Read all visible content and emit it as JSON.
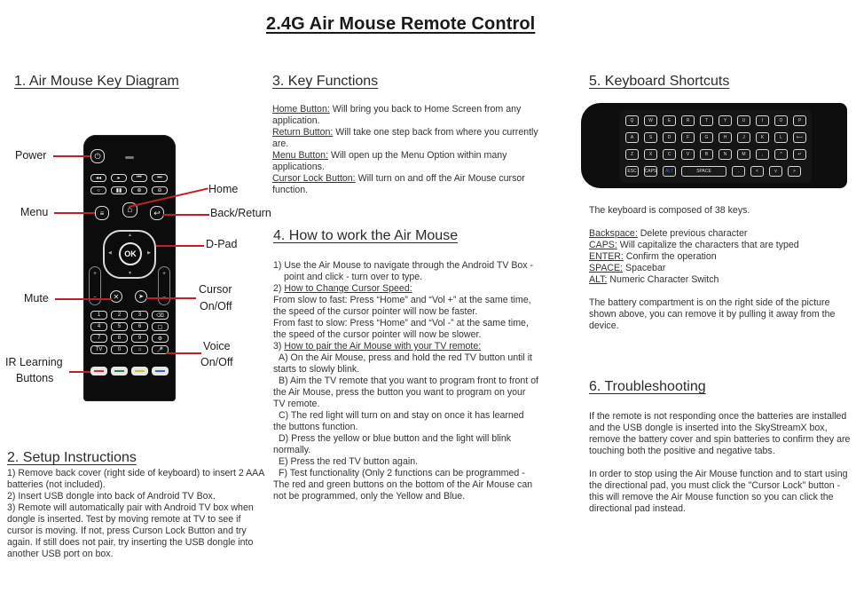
{
  "title": "2.4G Air Mouse Remote Control",
  "sections": {
    "key_diagram": {
      "heading": "1. Air Mouse Key Diagram",
      "labels": {
        "power": "Power",
        "home": "Home",
        "menu": "Menu",
        "back": "Back/Return",
        "dpad": "D-Pad",
        "mute": "Mute",
        "cursor_1": "Cursor",
        "cursor_2": "On/Off",
        "voice_1": "Voice",
        "voice_2": "On/Off",
        "ir_1": "IR Learning",
        "ir_2": "Buttons"
      },
      "remote": {
        "ok_label": "OK",
        "vol_plus": "+",
        "vol_minus": "−",
        "numpad": [
          "1",
          "2",
          "3",
          "⌫",
          "4",
          "5",
          "6",
          "▢",
          "7",
          "8",
          "9",
          "⚙",
          "TV",
          "0",
          "⌂",
          "🎤"
        ],
        "ir_colors": [
          "#c0303a",
          "#2f7a4a",
          "#c8c23a",
          "#3a5fc0"
        ]
      }
    },
    "setup": {
      "heading": "2. Setup Instructions",
      "items": [
        "1) Remove back cover (right side of keyboard) to insert 2 AAA batteries (not included).",
        "2) Insert USB dongle into back of Android TV Box.",
        "3) Remote will automatically pair with Android TV box when dongle is inserted. Test by moving remote at TV to see if cursor is moving. If not, press Curson Lock Button and try again. If still does not pair, try inserting the USB dongle into another USB port on box."
      ]
    },
    "key_functions": {
      "heading": "3. Key Functions",
      "items": [
        {
          "term": "Home Button:",
          "desc": " Will bring you back to Home Screen from any application."
        },
        {
          "term": "Return Button:",
          "desc": " Will take one step back from where you currently are."
        },
        {
          "term": "Menu Button:",
          "desc": " Will open up the Menu Option within many applications."
        },
        {
          "term": "Cursor Lock Button:",
          "desc": " Will turn on and off the Air Mouse cursor function."
        }
      ]
    },
    "how_to": {
      "heading": "4. How to work the Air Mouse",
      "step1": "1) Use the Air Mouse to navigate through the Android TV Box - point and click - turn over to type.",
      "step2_prefix": "2) ",
      "step2_title": "How to Change Cursor Speed:",
      "step2_lines": [
        "From slow to fast: Press “Home” and “Vol +” at the same time, the speed of the cursor pointer will now be faster.",
        "From fast to slow: Press “Home” and “Vol -” at the same time, the speed of the cursor pointer will now be slower."
      ],
      "step3_prefix": "3) ",
      "step3_title": "How to pair the Air Mouse with your TV remote:",
      "step3_items": [
        "A) On the Air Mouse, press and hold the red TV button until it starts to slowly blink.",
        "B) Aim the TV remote that you want to program front to front of the Air Mouse, press the button you want to program on your TV remote.",
        "C) The red light will turn on and stay on once it has learned the buttons function.",
        "D) Press the yellow or blue button and the light will blink normally.",
        "E) Press the red TV button again.",
        "F) Test functionality (Only 2 functions can be programmed - The red and green buttons on the bottom of the Air Mouse can not be programmed, only the Yellow and Blue."
      ]
    },
    "shortcuts": {
      "heading": "5. Keyboard Shortcuts",
      "keyboard_rows": [
        [
          "Q",
          "W",
          "E",
          "R",
          "T",
          "Y",
          "U",
          "I",
          "O",
          "P"
        ],
        [
          "A",
          "S",
          "D",
          "F",
          "G",
          "H",
          "J",
          "K",
          "L",
          "⟵"
        ],
        [
          "Z",
          "X",
          "C",
          "V",
          "B",
          "N",
          "M",
          ",",
          "^",
          "↵"
        ],
        [
          "ESC",
          "CAPS",
          "ALT",
          "SPACE",
          ".",
          "<",
          "v",
          ">"
        ]
      ],
      "intro": "The keyboard is composed of 38 keys.",
      "items": [
        {
          "term": "Backspace:",
          "desc": " Delete previous character"
        },
        {
          "term": "CAPS:",
          "desc": " Will capitalize the characters that are typed"
        },
        {
          "term": "ENTER:",
          "desc": " Confirm the operation"
        },
        {
          "term": "SPACE:",
          "desc": " Spacebar"
        },
        {
          "term": "ALT:",
          "desc": " Numeric Character Switch"
        }
      ],
      "battery": "The battery compartment is on the right side of the picture shown above, you can remove it by pulling it away from the device."
    },
    "troubleshooting": {
      "heading": "6. Troubleshooting",
      "para1": "If the remote is not responding once the batteries are installed and the USB dongle is inserted into the SkyStreamX box, remove the battery cover and spin batteries to confirm they are touching both the positive and negative tabs.",
      "para2": "In order to stop using the Air Mouse function and to start using the directional pad, you must click the \"Cursor Lock\" button - this will remove the Air Mouse function so you can click the directional pad instead."
    }
  },
  "colors": {
    "leader_line": "#c0202a"
  }
}
